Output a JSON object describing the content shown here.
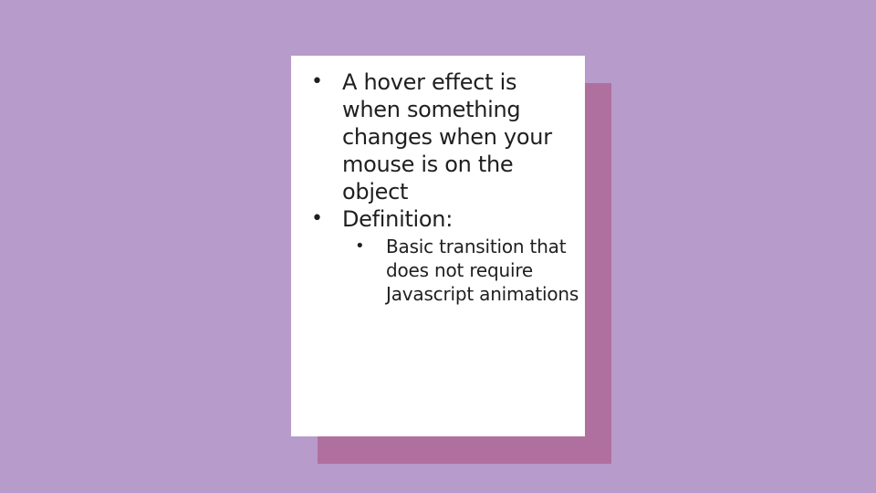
{
  "slide": {
    "background_color": "#b79bcb",
    "card_color": "#ffffff",
    "shadow_color": "#b0709f"
  },
  "content": {
    "bullets": [
      {
        "text": "A hover effect is when something changes when your mouse is on the object",
        "sub_bullets": []
      },
      {
        "text": "Definition:",
        "sub_bullets": [
          {
            "text": "Basic transition that does not require Javascript animations"
          }
        ]
      }
    ],
    "bullet_glyph": "•"
  }
}
